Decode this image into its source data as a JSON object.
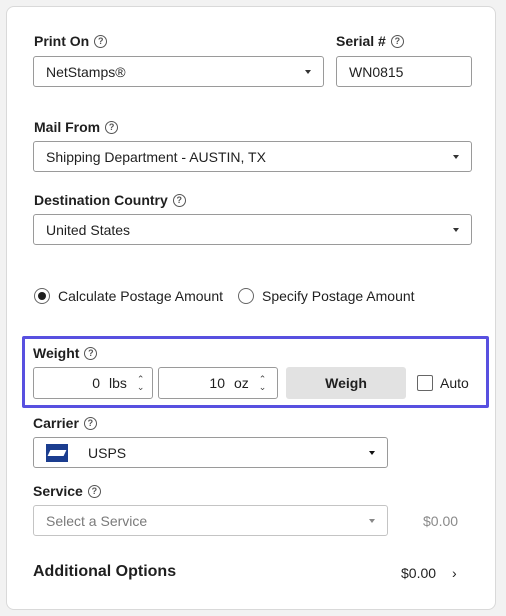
{
  "print_on": {
    "label": "Print On",
    "help_icon": "help-icon",
    "value": "NetStamps®"
  },
  "serial": {
    "label": "Serial #",
    "help_icon": "help-icon",
    "value": "WN0815"
  },
  "mail_from": {
    "label": "Mail From",
    "help_icon": "help-icon",
    "value": "Shipping Department - AUSTIN, TX"
  },
  "destination": {
    "label": "Destination Country",
    "help_icon": "help-icon",
    "value": "United States"
  },
  "postage_mode": {
    "calculate_label": "Calculate Postage Amount",
    "specify_label": "Specify Postage Amount",
    "selected": "calculate"
  },
  "weight": {
    "label": "Weight",
    "lbs_value": "0",
    "lbs_unit": "lbs",
    "oz_value": "10",
    "oz_unit": "oz",
    "weigh_button": "Weigh",
    "auto_label": "Auto",
    "auto_checked": false,
    "highlight_color": "#5850e0"
  },
  "carrier": {
    "label": "Carrier",
    "value": "USPS",
    "logo": "usps-eagle-logo"
  },
  "service": {
    "label": "Service",
    "placeholder": "Select a Service",
    "price": "$0.00"
  },
  "additional_options": {
    "label": "Additional Options",
    "price": "$0.00",
    "chevron": "chevron-right-icon"
  }
}
